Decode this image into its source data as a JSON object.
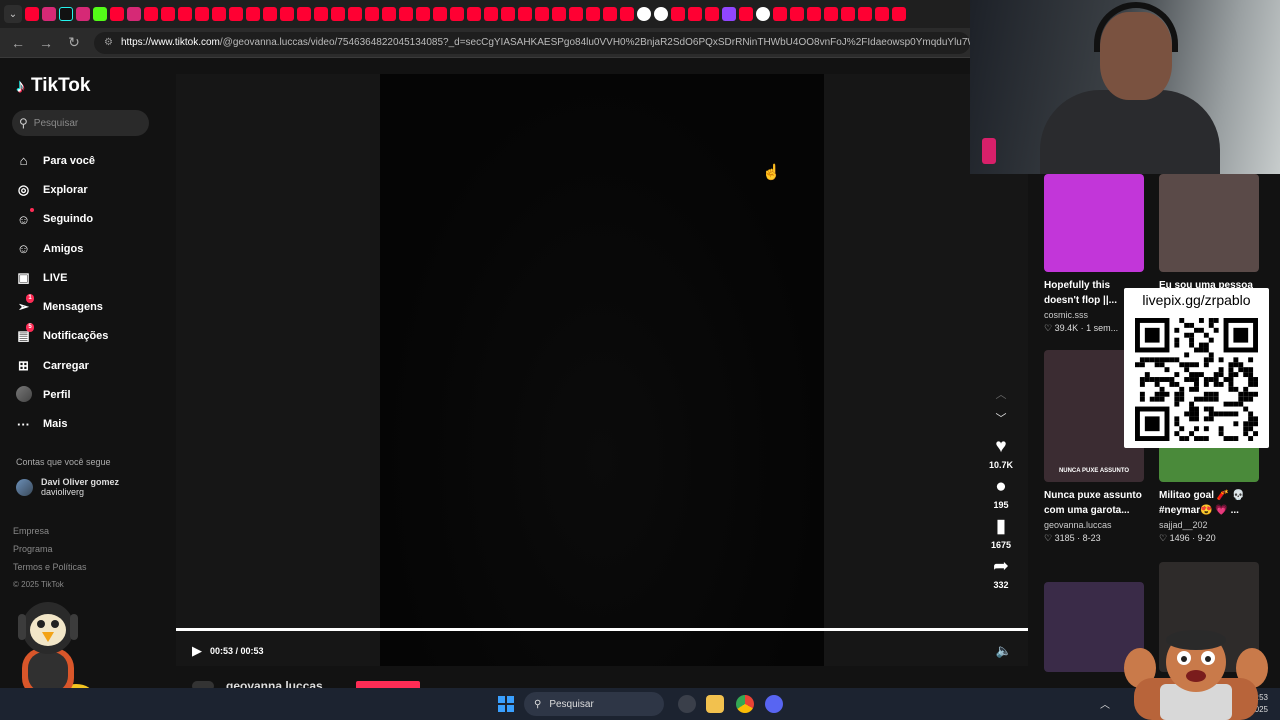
{
  "browser": {
    "url_domain": "https://www.tiktok.com",
    "url_path": "/@geovanna.luccas/video/7546364822045134085?_d=secCgYIASAHKAESPgo84lu0VVH0%2BnjaR2SdO6PQxSDrRNinTHWbU4OO8vnFoJ%2FIdaeowsp0YmqduYlu7WDhsDl%2BPsJzyLdKbm"
  },
  "app": {
    "logo": "TikTok",
    "search_placeholder": "Pesquisar"
  },
  "nav": [
    {
      "label": "Para você",
      "icon": "home-icon",
      "glyph": "⌂"
    },
    {
      "label": "Explorar",
      "icon": "compass-icon",
      "glyph": "◎"
    },
    {
      "label": "Seguindo",
      "icon": "following-icon",
      "glyph": "☺"
    },
    {
      "label": "Amigos",
      "icon": "friends-icon",
      "glyph": "☺"
    },
    {
      "label": "LIVE",
      "icon": "live-icon",
      "glyph": "▣"
    },
    {
      "label": "Mensagens",
      "icon": "messages-icon",
      "glyph": "➢",
      "badge": "1"
    },
    {
      "label": "Notificações",
      "icon": "notifications-icon",
      "glyph": "▤",
      "badge": "5"
    },
    {
      "label": "Carregar",
      "icon": "upload-icon",
      "glyph": "⊞"
    },
    {
      "label": "Perfil",
      "icon": "profile-avatar",
      "glyph": ""
    },
    {
      "label": "Mais",
      "icon": "more-icon",
      "glyph": "···"
    }
  ],
  "following": {
    "heading": "Contas que você segue",
    "accounts": [
      {
        "name": "Davi Oliver gomez",
        "handle": "davioliverg"
      }
    ]
  },
  "footer": {
    "links": [
      "Empresa",
      "Programa",
      "Termos e Políticas"
    ],
    "copyright": "© 2025 TikTok"
  },
  "player": {
    "time": "00:53 / 00:53",
    "progress": 1.0,
    "author": "geovanna.luccas"
  },
  "actions": {
    "likes": "10.7K",
    "comments": "195",
    "saves": "1675",
    "shares": "332"
  },
  "related": [
    {
      "title": "Hopefully this doesn't flop ||...",
      "author": "cosmic.sss",
      "likes": "39.4K",
      "date": "1 sem...",
      "color": "#c236d9"
    },
    {
      "title": "Eu sou uma pessoa",
      "author": "",
      "likes": "",
      "date": "",
      "color": "#5a4a48"
    },
    {
      "title": "Nunca puxe assunto com uma garota...",
      "author": "geovanna.luccas",
      "likes": "3185",
      "date": "8-23",
      "color": "#3b2c32",
      "overlay": "NUNCA PUXE ASSUNTO"
    },
    {
      "title": "Militao goal 🧨 💀 #neymar😍 💗 ...",
      "author": "sajjad__202",
      "likes": "1496",
      "date": "9-20",
      "color": "#4a8a3a"
    },
    {
      "title": "",
      "author": "",
      "likes": "",
      "date": "",
      "color": "#3a2b48"
    },
    {
      "title": "",
      "author": "",
      "likes": "",
      "date": "",
      "color": "#2e2b2a"
    }
  ],
  "overlay": {
    "qr_text": "livepix.gg/zrpablo"
  },
  "taskbar": {
    "search_label": "Pesquisar",
    "time": "11:53",
    "date": "15/10/2025"
  }
}
